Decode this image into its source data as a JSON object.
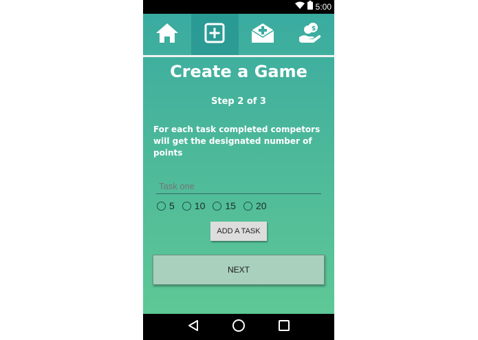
{
  "status_bar": {
    "time": "5:00",
    "icons": [
      "wifi-icon",
      "battery-icon"
    ]
  },
  "nav_tabs": [
    {
      "icon": "home-icon",
      "active": false
    },
    {
      "icon": "add-box-icon",
      "active": true
    },
    {
      "icon": "mail-add-icon",
      "active": false
    },
    {
      "icon": "money-hand-icon",
      "active": false
    }
  ],
  "screen": {
    "title": "Create a Game",
    "step": "Step 2 of 3",
    "instructions": "For each task completed competors will get the designated number of points"
  },
  "task": {
    "value": "",
    "placeholder": "Task one"
  },
  "points_options": [
    "5",
    "10",
    "15",
    "20"
  ],
  "buttons": {
    "add_task": "ADD A TASK",
    "next": "NEXT"
  },
  "system_nav": [
    "back-icon",
    "home-circle-icon",
    "recents-icon"
  ],
  "colors": {
    "gradient_top": "#3aaba0",
    "gradient_bottom": "#5ec896",
    "active_tab": "#2a9a98",
    "next_button": "#a8d0bd"
  }
}
